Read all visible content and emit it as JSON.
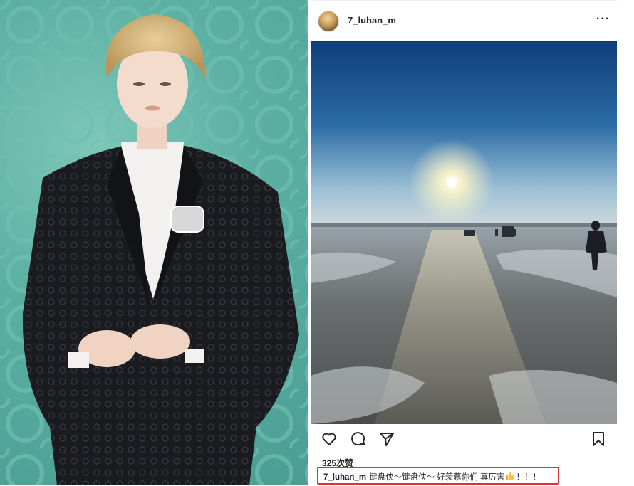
{
  "post": {
    "username": "7_luhan_m",
    "more_label": "···",
    "likes": "325次赞",
    "caption_user": "7_luhan_m",
    "caption_text_part1": "键盘侠～键盘侠～ 好羡慕你们 真厉害",
    "caption_text_part2": "！！！"
  },
  "icons": {
    "like": "heart-icon",
    "comment": "comment-icon",
    "share": "send-icon",
    "save": "bookmark-icon",
    "emoji": "thumbs-up-emoji"
  },
  "colors": {
    "highlight_border": "#e3312d",
    "text": "#262626",
    "left_background": "#5bb0a3"
  }
}
